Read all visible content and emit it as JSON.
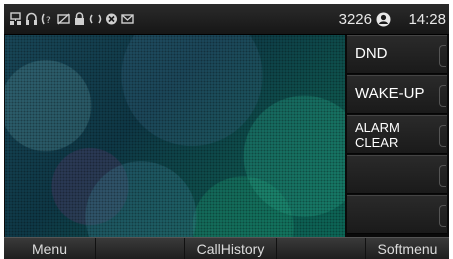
{
  "status_bar": {
    "icons": [
      "network-icon",
      "headset-icon",
      "call-forward-icon",
      "voicemail-icon",
      "lock-icon",
      "sync-icon",
      "dnd-icon",
      "missed-message-icon"
    ],
    "extension": "3226",
    "time": "14:28"
  },
  "line_keys": [
    {
      "label": "DND"
    },
    {
      "label": "WAKE-UP"
    },
    {
      "label": "ALARM\nCLEAR"
    },
    {
      "label": ""
    },
    {
      "label": ""
    }
  ],
  "softkeys": [
    {
      "label": "Menu"
    },
    {
      "label": ""
    },
    {
      "label": "CallHistory"
    },
    {
      "label": ""
    },
    {
      "label": "Softmenu"
    }
  ]
}
